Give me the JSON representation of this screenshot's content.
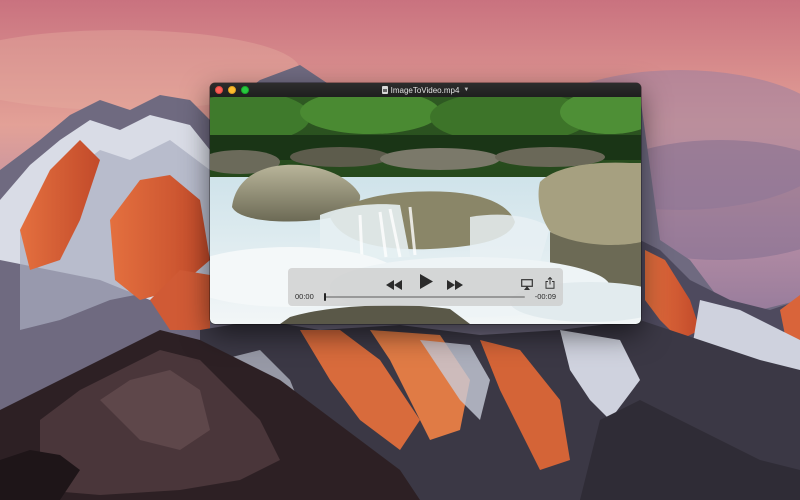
{
  "window": {
    "title": "ImageToVideo.mp4",
    "file_icon": "mp4-document-icon",
    "title_menu_icon": "chevron-down-icon"
  },
  "controls": {
    "time_elapsed": "00:00",
    "time_remaining": "-00:09",
    "progress_fraction": 0.0,
    "icons": {
      "rewind": "rewind-icon",
      "play": "play-icon",
      "fast_forward": "fast-forward-icon",
      "airplay": "airplay-icon",
      "share": "share-icon"
    }
  },
  "colors": {
    "close": "#fc5f57",
    "minimize": "#fdbc2e",
    "maximize": "#28c840",
    "titlebar": "#232323",
    "hud": "#cdcdcd"
  }
}
